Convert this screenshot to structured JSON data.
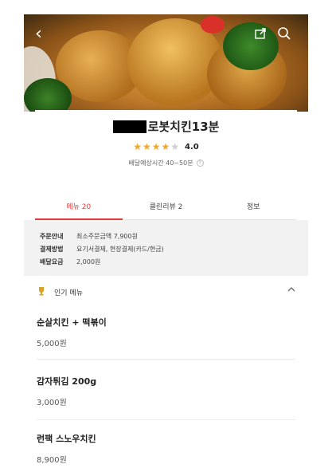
{
  "store": {
    "name_suffix": "로봇치킨13분",
    "rating_value": 4.0,
    "rating_text": "4.0",
    "stars_filled": 4,
    "stars_total": 5,
    "delivery_time": "배달예상시간 40~50분",
    "help_icon": "?"
  },
  "tabs": [
    {
      "label": "메뉴 20",
      "active": true
    },
    {
      "label": "클린리뷰 2",
      "active": false
    },
    {
      "label": "정보",
      "active": false
    }
  ],
  "order_info": [
    {
      "key": "주문안내",
      "value": "최소주문금액 7,900원"
    },
    {
      "key": "결제방법",
      "value": "요기서결제, 현장결제(카드/현금)"
    },
    {
      "key": "배달요금",
      "value": "2,000원"
    }
  ],
  "popular": {
    "title": "인기 메뉴",
    "items": [
      {
        "name": "순살치킨 + 떡볶이",
        "price": "5,000원"
      },
      {
        "name": "감자튀김 200g",
        "price": "3,000원"
      },
      {
        "name": "런팩 스노우치킨",
        "price": "8,900원"
      }
    ]
  },
  "icons": {
    "back": "back-arrow-icon",
    "share": "share-icon",
    "search": "search-icon",
    "trophy": "trophy-icon",
    "collapse": "chevron-up-icon"
  },
  "colors": {
    "accent": "#e03a3a",
    "star": "#f5a623"
  }
}
